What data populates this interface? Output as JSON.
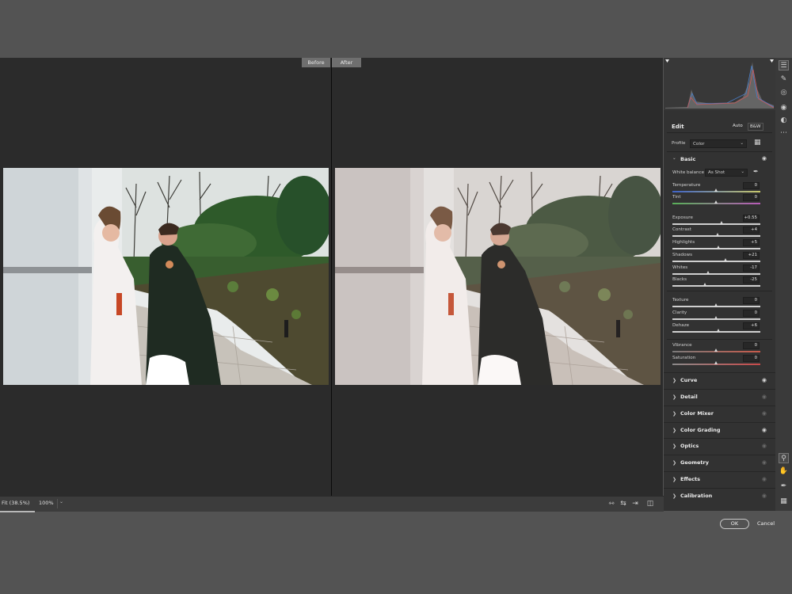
{
  "compare": {
    "before_label": "Before",
    "after_label": "After"
  },
  "status": {
    "zoom_fit": "Fit (38.5%)",
    "zoom_100": "100%"
  },
  "panel": {
    "edit_title": "Edit",
    "auto_label": "Auto",
    "bw_label": "B&W",
    "profile_label": "Profile",
    "profile_value": "Color",
    "basic_title": "Basic",
    "white_balance_label": "White balance",
    "white_balance_value": "As Shot",
    "sliders": [
      {
        "label": "Temperature",
        "value": "0",
        "level": 0.5
      },
      {
        "label": "Tint",
        "value": "0",
        "level": 0.5
      },
      {
        "label": "Exposure",
        "value": "+0.55",
        "level": 0.56
      },
      {
        "label": "Contrast",
        "value": "+4",
        "level": 0.52
      },
      {
        "label": "Highlights",
        "value": "+5",
        "level": 0.53
      },
      {
        "label": "Shadows",
        "value": "+21",
        "level": 0.61
      },
      {
        "label": "Whites",
        "value": "-17",
        "level": 0.41
      },
      {
        "label": "Blacks",
        "value": "-25",
        "level": 0.37
      },
      {
        "label": "Texture",
        "value": "0",
        "level": 0.5
      },
      {
        "label": "Clarity",
        "value": "0",
        "level": 0.5
      },
      {
        "label": "Dehaze",
        "value": "+6",
        "level": 0.53
      },
      {
        "label": "Vibrance",
        "value": "0",
        "level": 0.5
      },
      {
        "label": "Saturation",
        "value": "0",
        "level": 0.5
      }
    ],
    "sections": [
      {
        "name": "Curve",
        "eye_on": true
      },
      {
        "name": "Detail",
        "eye_on": false
      },
      {
        "name": "Color Mixer",
        "eye_on": false
      },
      {
        "name": "Color Grading",
        "eye_on": true
      },
      {
        "name": "Optics",
        "eye_on": false
      },
      {
        "name": "Geometry",
        "eye_on": false
      },
      {
        "name": "Effects",
        "eye_on": false
      },
      {
        "name": "Calibration",
        "eye_on": false
      }
    ]
  },
  "dialog": {
    "ok_label": "OK",
    "cancel_label": "Cancel"
  }
}
